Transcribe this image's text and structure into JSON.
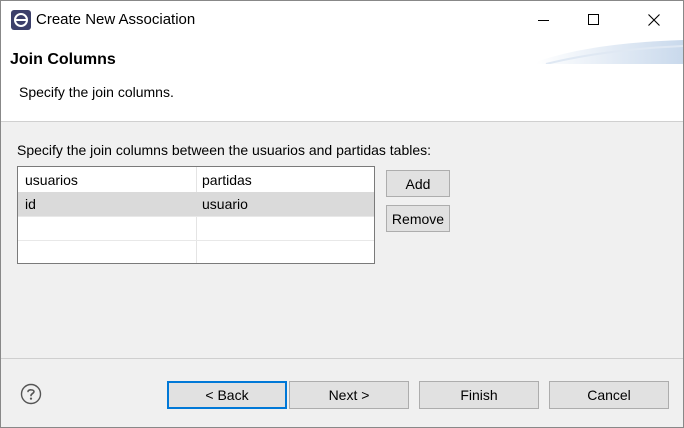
{
  "window": {
    "title": "Create New Association",
    "icon": "eclipse-app-icon"
  },
  "banner": {
    "title": "Join Columns",
    "description": "Specify the join columns."
  },
  "content": {
    "instruction": "Specify the join columns between the usuarios and partidas tables:",
    "table": {
      "columns": [
        "usuarios",
        "partidas"
      ],
      "rows": [
        [
          "id",
          "usuario"
        ],
        [
          "",
          ""
        ],
        [
          "",
          ""
        ]
      ],
      "selected_row_index": 0
    },
    "add_label": "Add",
    "remove_label": "Remove"
  },
  "footer": {
    "help_icon": "help-icon",
    "back_label": "< Back",
    "next_label": "Next >",
    "finish_label": "Finish",
    "cancel_label": "Cancel"
  },
  "colors": {
    "selected_row": "#dadada",
    "default_button_border": "#0078d7",
    "dialog_background": "#f0f0f0"
  }
}
